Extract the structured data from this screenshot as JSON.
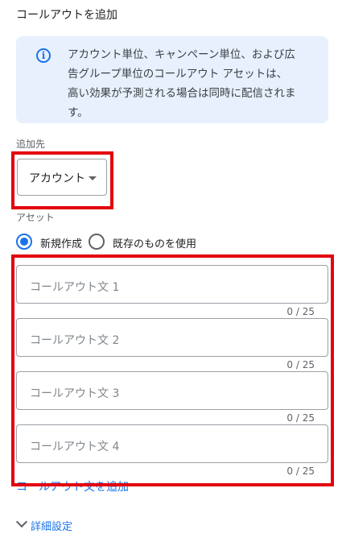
{
  "panel": {
    "title": "コールアウトを追加",
    "info": {
      "icon": "info-icon",
      "lines": [
        "アカウント単位、キャンペーン単位、および広",
        "告グループ単位のコールアウト アセットは、",
        "高い効果が予測される場合は同時に配信されま",
        "す。"
      ]
    },
    "destination": {
      "label": "追加先",
      "selected": "アカウント"
    },
    "asset": {
      "label": "アセット",
      "options": [
        "新規作成",
        "既存のものを使用"
      ],
      "selected": "新規作成"
    },
    "fields": [
      {
        "placeholder": "コールアウト文 1",
        "counter": "0 / 25"
      },
      {
        "placeholder": "コールアウト文 2",
        "counter": "0 / 25"
      },
      {
        "placeholder": "コールアウト文 3",
        "counter": "0 / 25"
      },
      {
        "placeholder": "コールアウト文 4",
        "counter": "0 / 25"
      }
    ],
    "add_link": "コールアウト文を追加",
    "advanced": "詳細設定"
  },
  "colors": {
    "accent": "#1a73e8",
    "highlight": "#e3000f",
    "info_bg": "#e8f0fe"
  }
}
